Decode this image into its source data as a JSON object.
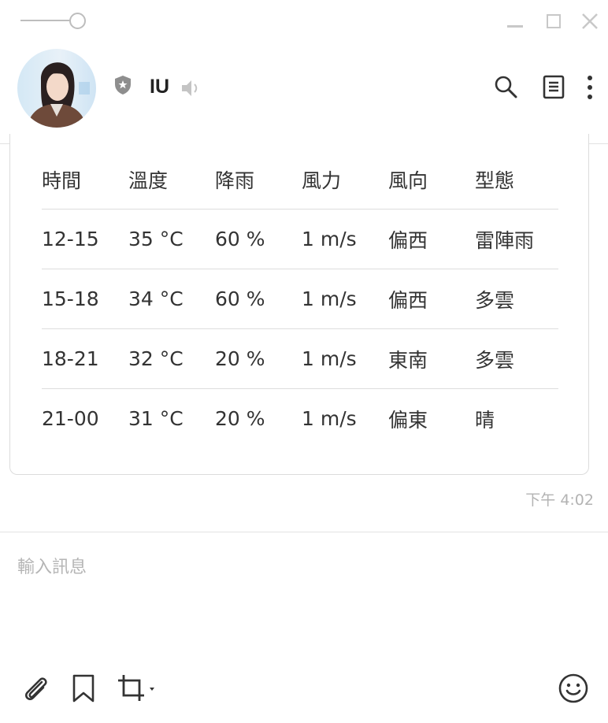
{
  "window": {
    "controls": [
      "opacity-slider",
      "minimize-icon",
      "maximize-icon",
      "close-icon"
    ]
  },
  "header": {
    "contact_name": "IU",
    "icons": [
      "shield-star-icon",
      "speaker-icon",
      "search-icon",
      "notes-icon",
      "more-vertical-icon"
    ]
  },
  "weather_table": {
    "columns": [
      "時間",
      "溫度",
      "降雨",
      "風力",
      "風向",
      "型態"
    ],
    "rows": [
      [
        "12-15",
        "35 °C",
        "60 %",
        "1 m/s",
        "偏西",
        "雷陣雨"
      ],
      [
        "15-18",
        "34 °C",
        "60 %",
        "1 m/s",
        "偏西",
        "多雲"
      ],
      [
        "18-21",
        "32 °C",
        "20 %",
        "1 m/s",
        "東南",
        "多雲"
      ],
      [
        "21-00",
        "31 °C",
        "20 %",
        "1 m/s",
        "偏東",
        "晴"
      ]
    ]
  },
  "message": {
    "timestamp": "下午 4:02"
  },
  "composer": {
    "placeholder": "輸入訊息",
    "value": "",
    "tools": [
      "paperclip-icon",
      "bookmark-icon",
      "crop-icon",
      "emoji-icon"
    ]
  },
  "colors": {
    "icon_dark": "#333333",
    "icon_light": "#bdbdbd",
    "divider": "#e2e2e2",
    "timestamp": "#b3b3b3"
  }
}
